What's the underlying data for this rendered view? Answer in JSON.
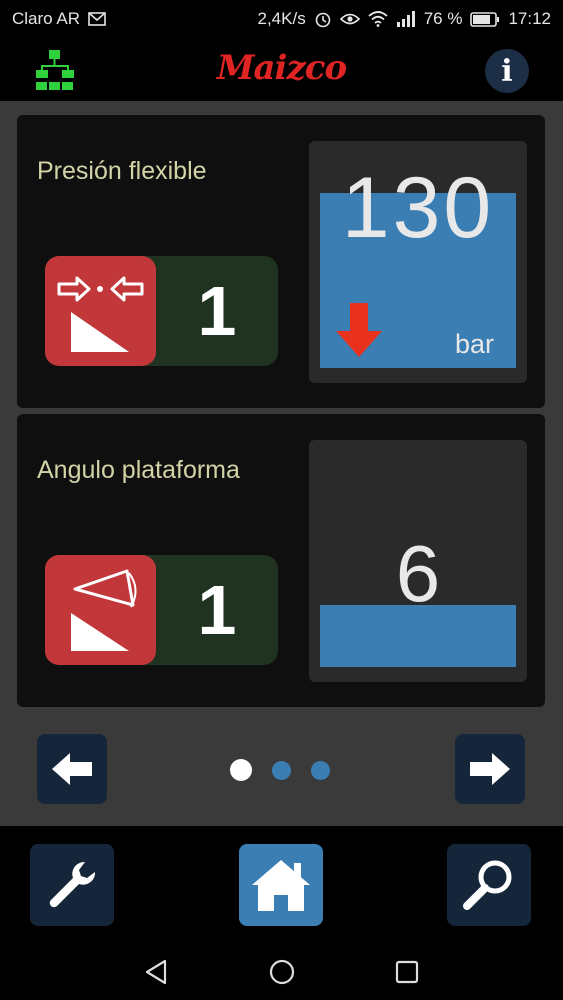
{
  "status_bar": {
    "carrier": "Claro AR",
    "speed": "2,4K/s",
    "battery": "76 %",
    "time": "17:12"
  },
  "header": {
    "logo": "Maizco",
    "info_label": "i",
    "network_icon": "network-tree-icon"
  },
  "cards": [
    {
      "title": "Presión flexible",
      "mode_number": "1",
      "value": "130",
      "unit": "bar",
      "icon": "pressure-icon",
      "trend_icon": "down-arrow-icon"
    },
    {
      "title": "Angulo plataforma",
      "mode_number": "1",
      "value": "6",
      "icon": "angle-icon"
    }
  ],
  "pager": {
    "pages": 3,
    "active_page": 1
  },
  "toolbar": {
    "items": [
      "wrench-icon",
      "home-icon",
      "search-icon"
    ]
  },
  "colors": {
    "accent_blue": "#3b7eb4",
    "alert_red": "#c2373a",
    "logo_red": "#e02424",
    "pill_green": "#1f3320",
    "title_text": "#d3d3a8"
  }
}
